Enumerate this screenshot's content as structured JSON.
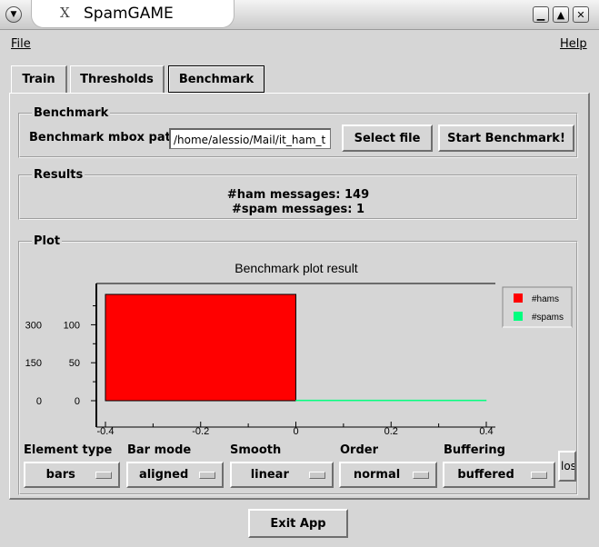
{
  "window": {
    "title": "SpamGAME",
    "controls": [
      "minimize",
      "maximize",
      "close"
    ]
  },
  "menu": {
    "file": "File",
    "help": "Help"
  },
  "tabs": [
    {
      "label": "Train",
      "active": false
    },
    {
      "label": "Thresholds",
      "active": false
    },
    {
      "label": "Benchmark",
      "active": true
    }
  ],
  "benchmark": {
    "group_title": "Benchmark",
    "path_label": "Benchmark mbox path:",
    "path_value": "/home/alessio/Mail/it_ham_t",
    "select_file": "Select file",
    "start": "Start Benchmark!"
  },
  "results": {
    "group_title": "Results",
    "line1": "#ham messages: 149",
    "line2": "#spam messages: 1"
  },
  "plot": {
    "group_title": "Plot",
    "y2_ticks": [
      "300",
      "150",
      "0"
    ]
  },
  "chart_data": {
    "type": "bar",
    "title": "Benchmark plot result",
    "xlim": [
      -0.4,
      0.4
    ],
    "ylim": [
      0,
      140
    ],
    "x_ticks": [
      "-0.4",
      "-0.2",
      "0",
      "0.2",
      "0.4"
    ],
    "y_ticks": [
      "100",
      "50",
      "0"
    ],
    "legend_position": "right",
    "series": [
      {
        "name": "#hams",
        "color": "#ff0000",
        "bars": [
          {
            "x_start": -0.4,
            "x_end": 0.0,
            "value": 149
          }
        ]
      },
      {
        "name": "#spams",
        "color": "#00ff7f",
        "bars": [
          {
            "x_start": 0.0,
            "x_end": 0.4,
            "value": 1
          }
        ]
      }
    ]
  },
  "options": {
    "element_type": {
      "label": "Element type",
      "value": "bars"
    },
    "bar_mode": {
      "label": "Bar mode",
      "value": "aligned"
    },
    "smooth": {
      "label": "Smooth",
      "value": "linear"
    },
    "order": {
      "label": "Order",
      "value": "normal"
    },
    "buffering": {
      "label": "Buffering",
      "value": "buffered"
    },
    "close_partial": "los"
  },
  "footer": {
    "exit": "Exit App"
  }
}
